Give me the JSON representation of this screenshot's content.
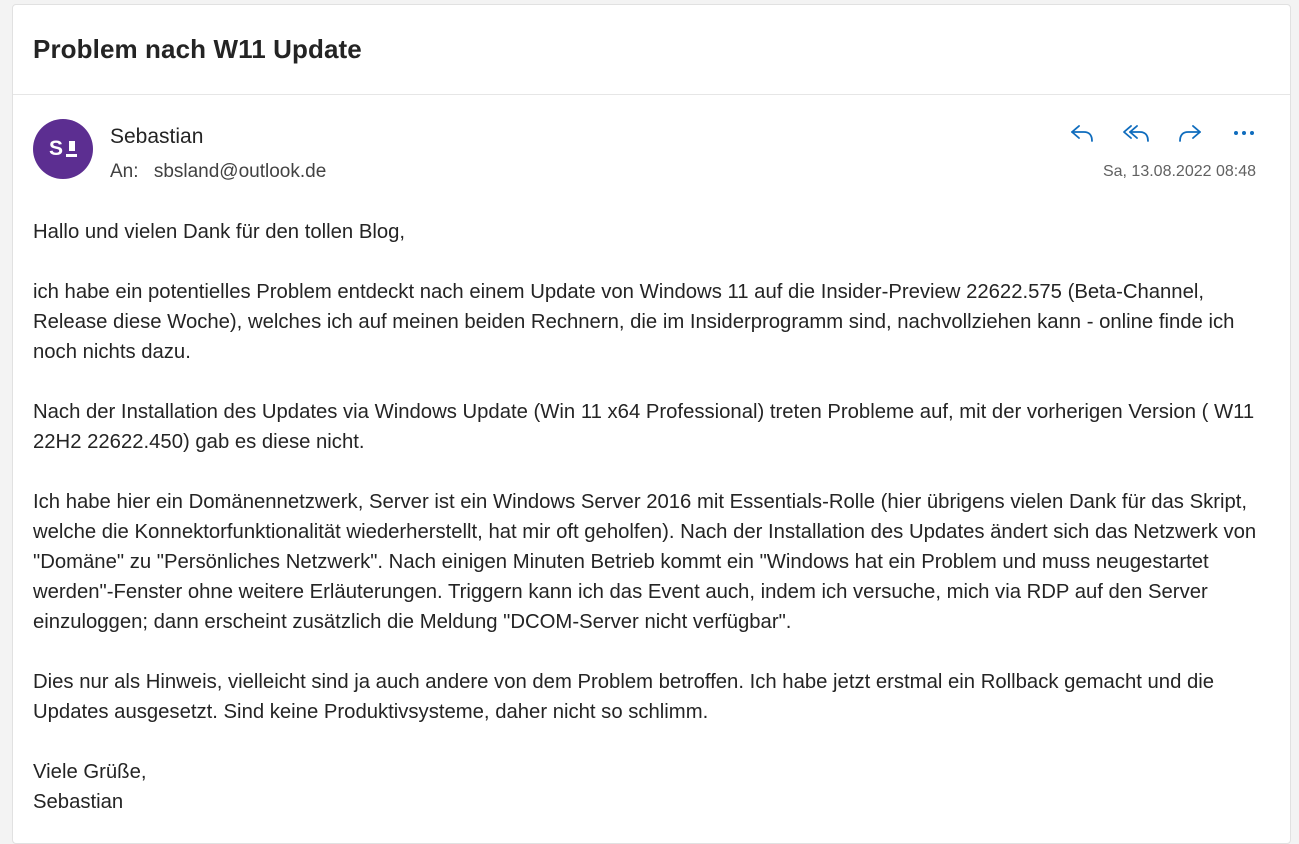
{
  "email": {
    "subject": "Problem nach W11 Update",
    "sender": {
      "name": "Sebastian",
      "avatar_letter": "S",
      "avatar_color": "#5c2e91"
    },
    "to_label": "An:",
    "to_address": "sbsland@outlook.de",
    "date": "Sa, 13.08.2022 08:48",
    "actions": [
      {
        "name": "reply",
        "icon": "reply-icon"
      },
      {
        "name": "reply-all",
        "icon": "reply-all-icon"
      },
      {
        "name": "forward",
        "icon": "forward-icon"
      },
      {
        "name": "more",
        "icon": "more-icon"
      }
    ],
    "accent_color": "#0f6cbd",
    "body": {
      "greeting": "Hallo und vielen Dank für den tollen Blog,",
      "p1": "ich habe ein potentielles Problem entdeckt nach einem Update von Windows 11 auf die Insider-Preview 22622.575 (Beta-Channel, Release diese Woche), welches ich auf meinen beiden Rechnern, die im Insiderprogramm sind, nachvollziehen kann - online finde ich noch nichts dazu.",
      "p2": "Nach der Installation des Updates via Windows Update (Win 11 x64 Professional) treten Probleme auf, mit der vorherigen Version ( W11 22H2 22622.450) gab es diese nicht.",
      "p3": "Ich habe hier ein Domänennetzwerk, Server ist ein Windows Server 2016 mit Essentials-Rolle (hier übrigens vielen Dank für das Skript, welche die Konnektorfunktionalität wiederherstellt, hat mir oft geholfen). Nach der Installation des Updates ändert sich das Netzwerk von \"Domäne\" zu \"Persönliches Netzwerk\". Nach einigen Minuten Betrieb kommt ein \"Windows hat ein Problem und muss neugestartet werden\"-Fenster ohne weitere Erläuterungen. Triggern kann ich das Event auch, indem ich versuche, mich via RDP auf den Server einzuloggen; dann erscheint zusätzlich die Meldung \"DCOM-Server nicht verfügbar\".",
      "p4": "Dies nur als Hinweis, vielleicht sind ja auch andere von dem Problem betroffen. Ich habe jetzt erstmal ein Rollback gemacht und die Updates ausgesetzt. Sind keine Produktivsysteme, daher nicht so schlimm.",
      "closing_line1": "Viele Grüße,",
      "closing_line2": "Sebastian"
    }
  }
}
